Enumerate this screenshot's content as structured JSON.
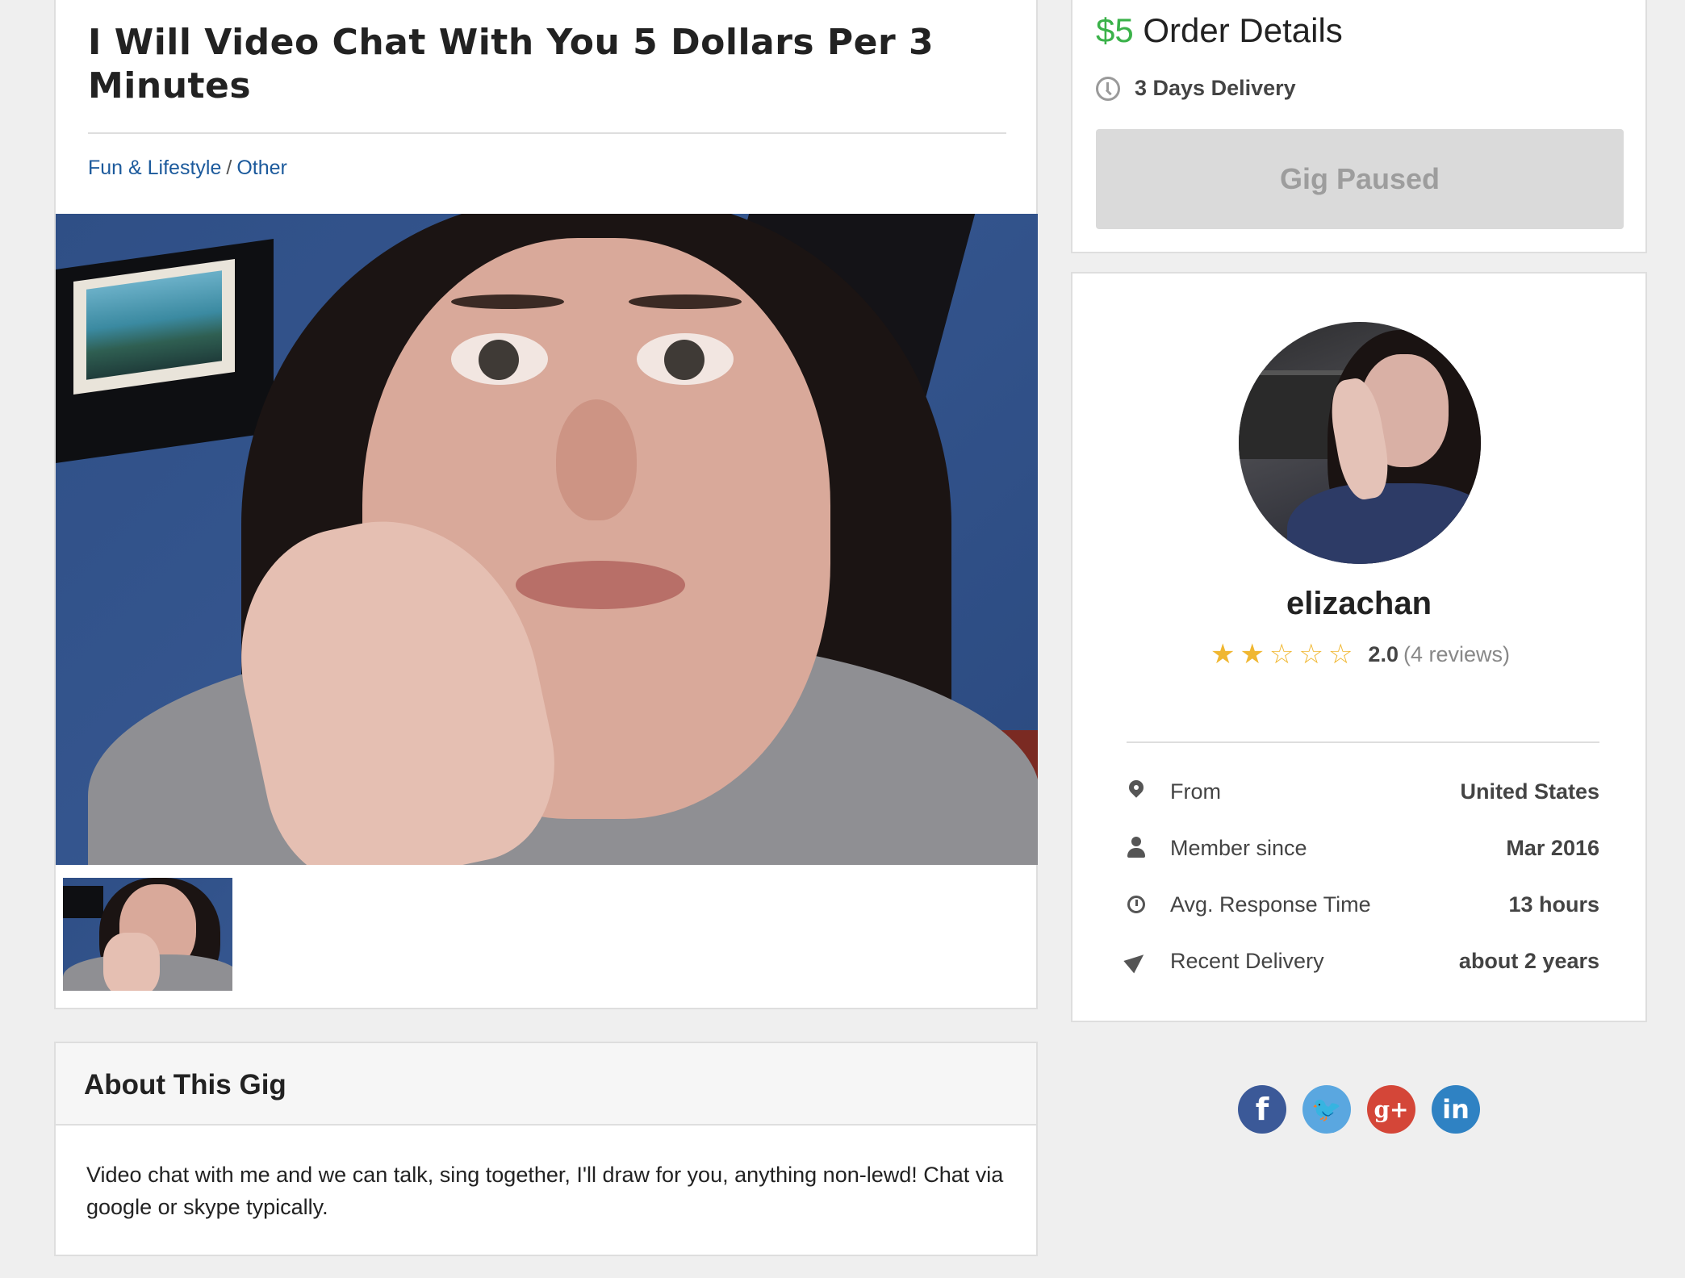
{
  "gig": {
    "title": "I Will Video Chat With You 5 Dollars Per 3 Minutes",
    "breadcrumb": {
      "category": "Fun & Lifestyle",
      "separator": "/",
      "subcategory": "Other"
    }
  },
  "about": {
    "heading": "About This Gig",
    "description": "Video chat with me and we can talk, sing together, I'll draw for you, anything non-lewd! Chat via google or skype typically."
  },
  "order": {
    "price": "$5",
    "heading": "Order Details",
    "delivery": "3 Days Delivery",
    "button_label": "Gig Paused"
  },
  "seller": {
    "username": "elizachan",
    "rating": 2,
    "rating_max": 5,
    "rating_score": "2.0",
    "reviews": "(4 reviews)",
    "stats": [
      {
        "icon": "map-pin-icon",
        "label": "From",
        "value": "United States"
      },
      {
        "icon": "user-icon",
        "label": "Member since",
        "value": "Mar 2016"
      },
      {
        "icon": "clock-icon",
        "label": "Avg. Response Time",
        "value": "13 hours"
      },
      {
        "icon": "paper-plane-icon",
        "label": "Recent Delivery",
        "value": "about 2 years"
      }
    ]
  },
  "social": {
    "facebook": "f",
    "twitter": "🐦",
    "google_plus": "g+",
    "linkedin": "in"
  },
  "colors": {
    "price_green": "#3bb24a",
    "link_blue": "#1c5a9c",
    "star_gold": "#f0b731",
    "button_disabled": "#dadada"
  }
}
